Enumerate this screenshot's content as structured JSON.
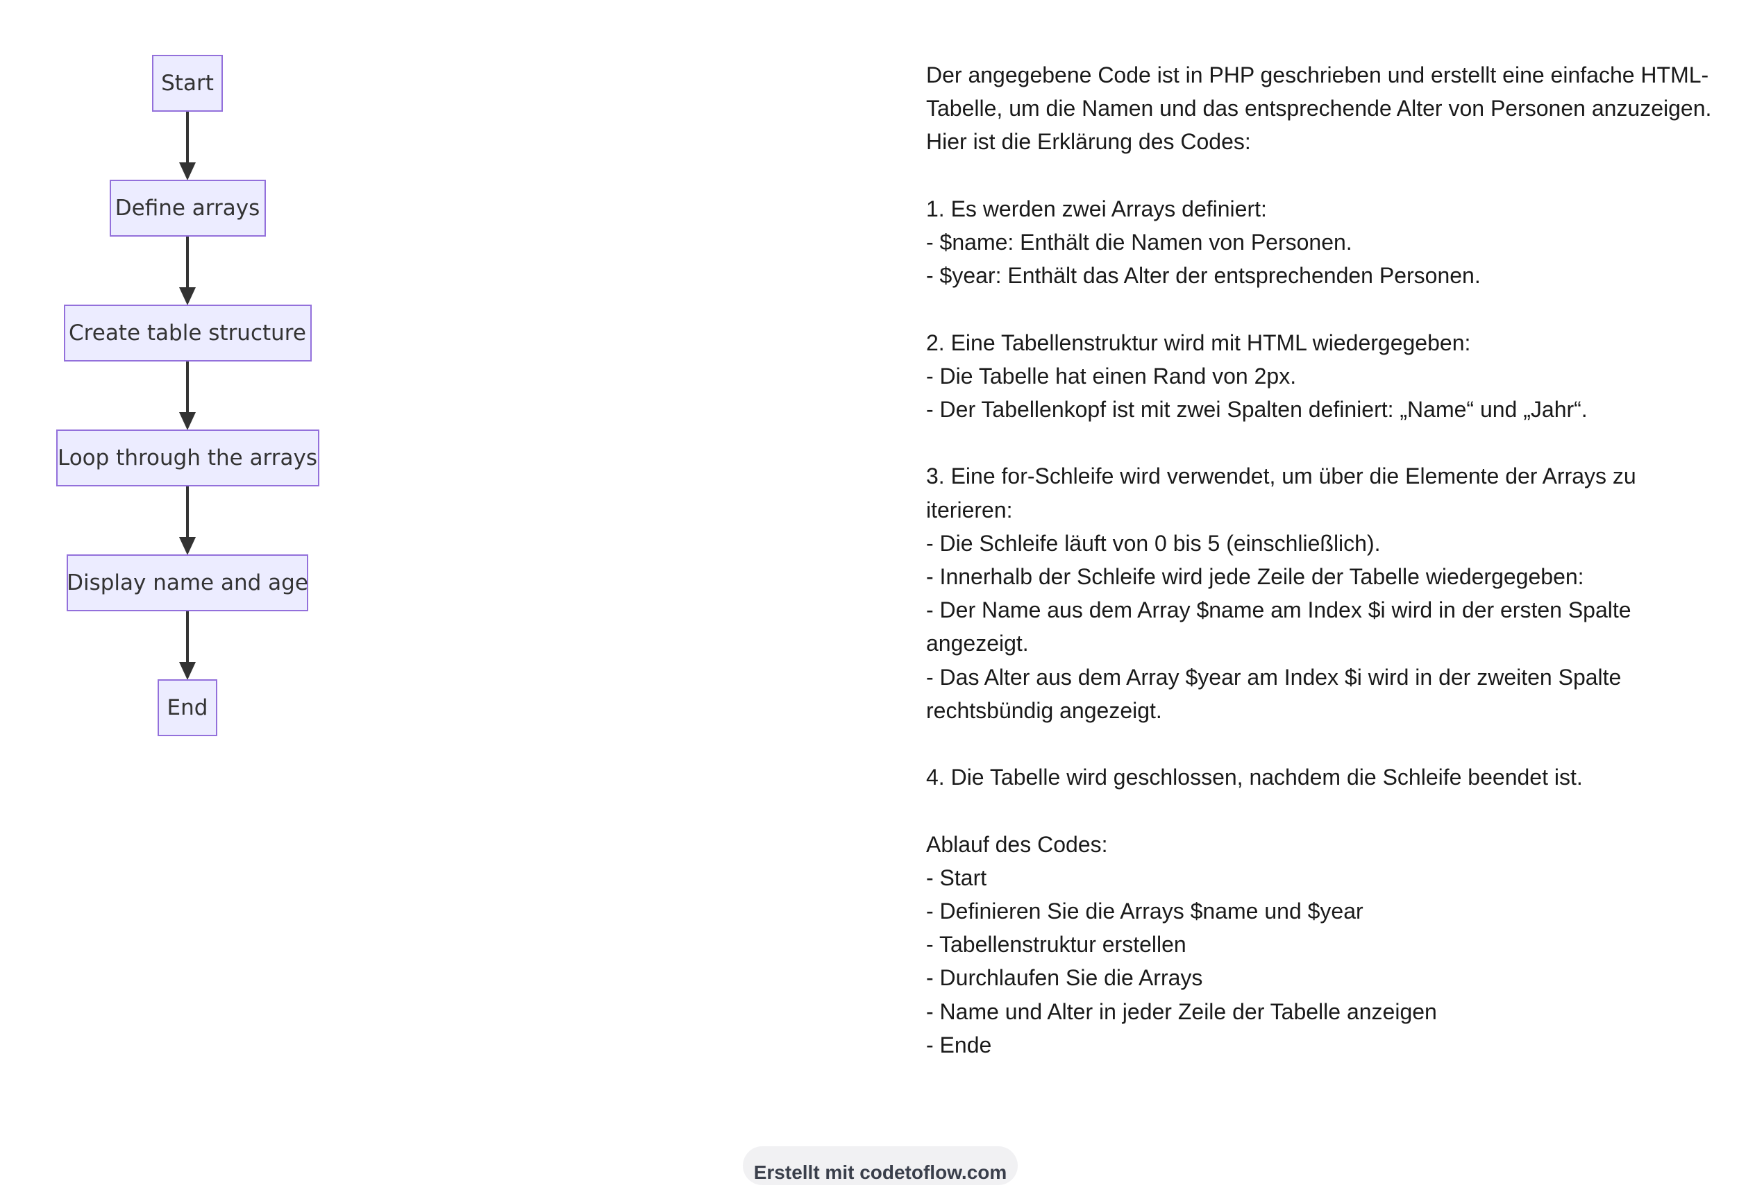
{
  "flowchart": {
    "nodes": [
      {
        "id": "start",
        "label": "Start"
      },
      {
        "id": "define",
        "label": "Define arrays"
      },
      {
        "id": "create",
        "label": "Create table structure"
      },
      {
        "id": "loop",
        "label": "Loop through the arrays"
      },
      {
        "id": "display",
        "label": "Display name and age"
      },
      {
        "id": "end",
        "label": "End"
      }
    ],
    "edges": [
      {
        "from": "start",
        "to": "define"
      },
      {
        "from": "define",
        "to": "create"
      },
      {
        "from": "create",
        "to": "loop"
      },
      {
        "from": "loop",
        "to": "display"
      },
      {
        "from": "display",
        "to": "end"
      }
    ],
    "colors": {
      "node_fill": "#ececff",
      "node_stroke": "#9370db",
      "edge": "#333333"
    }
  },
  "explanation": {
    "lines": [
      "Der angegebene Code ist in PHP geschrieben und erstellt eine einfache HTML-",
      "Tabelle, um die Namen und das entsprechende Alter von Personen anzuzeigen.",
      "Hier ist die Erklärung des Codes:",
      "",
      "1. Es werden zwei Arrays definiert:",
      "- $name: Enthält die Namen von Personen.",
      "- $year: Enthält das Alter der entsprechenden Personen.",
      "",
      "2. Eine Tabellenstruktur wird mit HTML wiedergegeben:",
      "- Die Tabelle hat einen Rand von 2px.",
      "- Der Tabellenkopf ist mit zwei Spalten definiert: „Name“ und „Jahr“.",
      "",
      "3. Eine for-Schleife wird verwendet, um über die Elemente der Arrays zu",
      "iterieren:",
      "- Die Schleife läuft von 0 bis 5 (einschließlich).",
      "- Innerhalb der Schleife wird jede Zeile der Tabelle wiedergegeben:",
      "- Der Name aus dem Array $name am Index $i wird in der ersten Spalte",
      "angezeigt.",
      "- Das Alter aus dem Array $year am Index $i wird in der zweiten Spalte",
      "rechtsbündig angezeigt.",
      "",
      "4. Die Tabelle wird geschlossen, nachdem die Schleife beendet ist.",
      "",
      "Ablauf des Codes:",
      "- Start",
      "- Definieren Sie die Arrays $name und $year",
      "- Tabellenstruktur erstellen",
      "- Durchlaufen Sie die Arrays",
      "- Name und Alter in jeder Zeile der Tabelle anzeigen",
      "- Ende"
    ]
  },
  "footer": {
    "text": "Erstellt mit codetoflow.com"
  }
}
